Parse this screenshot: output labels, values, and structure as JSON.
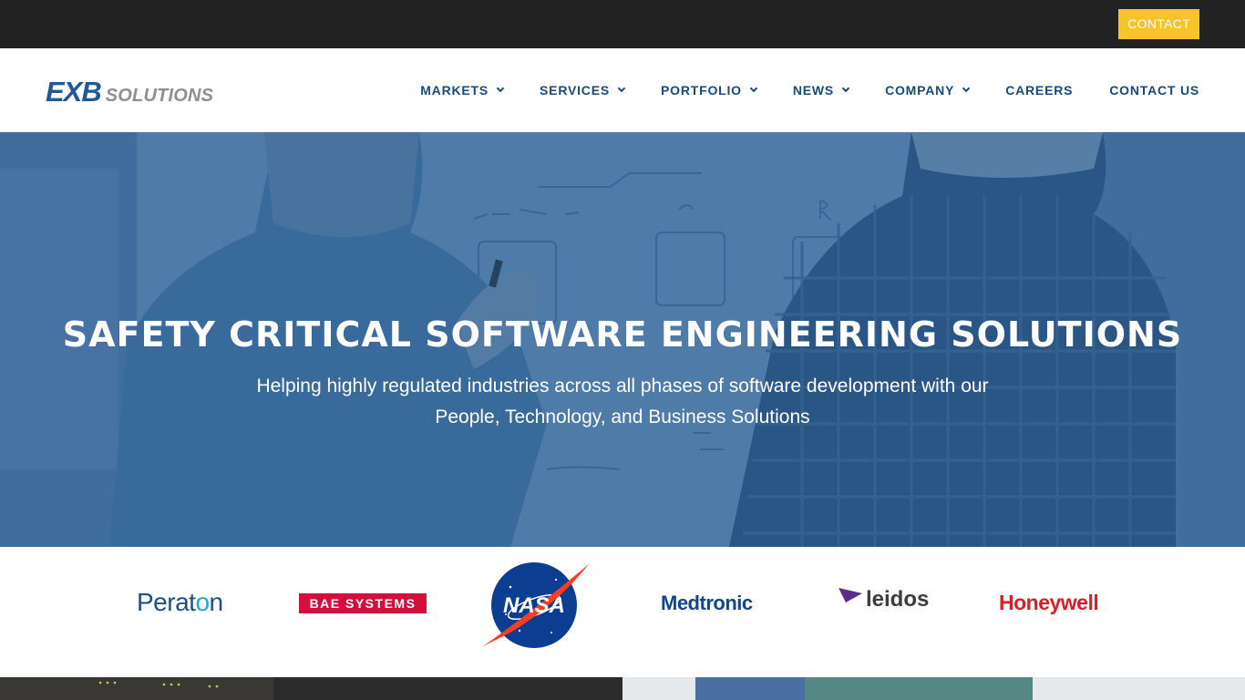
{
  "topbar": {
    "contact_label": "CONTACT"
  },
  "brand": {
    "exb": "EXB",
    "solutions": "SOLUTIONS"
  },
  "nav": [
    {
      "label": "MARKETS",
      "dropdown": true
    },
    {
      "label": "SERVICES",
      "dropdown": true
    },
    {
      "label": "PORTFOLIO",
      "dropdown": true
    },
    {
      "label": "NEWS",
      "dropdown": true
    },
    {
      "label": "COMPANY",
      "dropdown": true
    },
    {
      "label": "CAREERS",
      "dropdown": false
    },
    {
      "label": "CONTACT US",
      "dropdown": false
    }
  ],
  "hero": {
    "title": "SAFETY CRITICAL SOFTWARE ENGINEERING SOLUTIONS",
    "subtitle_line1": "Helping highly regulated industries across all phases of software development with our",
    "subtitle_line2": "People, Technology, and Business Solutions"
  },
  "clients": {
    "peraton_a": "Perat",
    "peraton_b": "o",
    "peraton_c": "n",
    "bae": "BAE SYSTEMS",
    "nasa": "NASA",
    "medtronic": "Medtronic",
    "leidos": "leidos",
    "honeywell": "Honeywell"
  },
  "colors": {
    "topbar": "#222222",
    "accent": "#f9c32b",
    "nav_text": "#184a7a",
    "hero_overlay": "#285c94"
  }
}
